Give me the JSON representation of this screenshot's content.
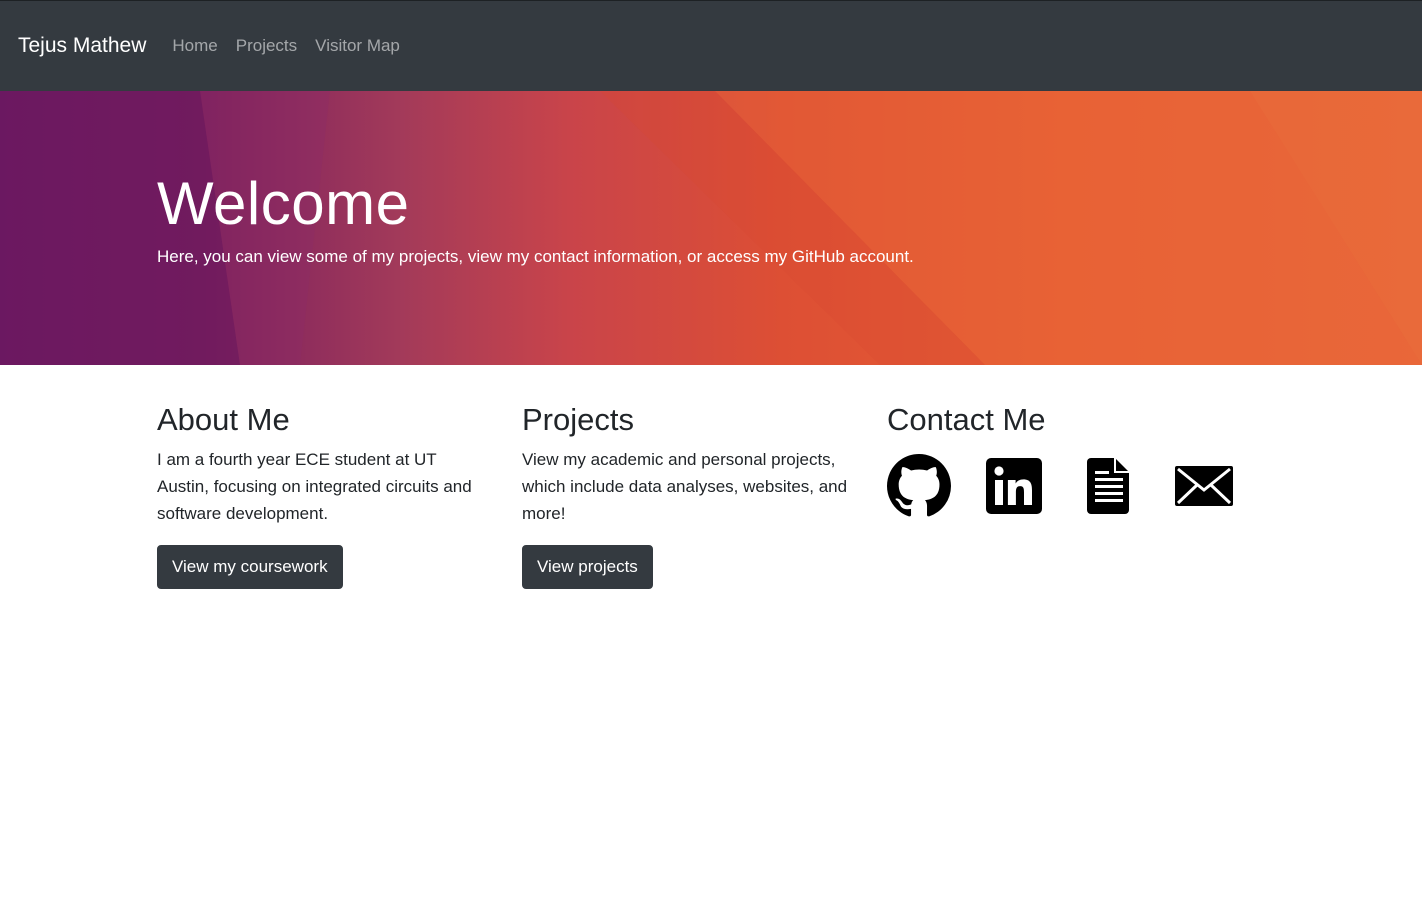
{
  "navbar": {
    "brand": "Tejus Mathew",
    "links": [
      {
        "label": "Home"
      },
      {
        "label": "Projects"
      },
      {
        "label": "Visitor Map"
      }
    ]
  },
  "hero": {
    "title": "Welcome",
    "lead": "Here, you can view some of my projects, view my contact information, or access my GitHub account."
  },
  "about": {
    "heading": "About Me",
    "text": "I am a fourth year ECE student at UT Austin, focusing on integrated circuits and software development.",
    "button": "View my coursework"
  },
  "projects": {
    "heading": "Projects",
    "text": "View my academic and personal projects, which include data analyses, websites, and more!",
    "button": "View projects"
  },
  "contact": {
    "heading": "Contact Me",
    "icons": [
      "github-icon",
      "linkedin-icon",
      "resume-document-icon",
      "email-envelope-icon"
    ]
  },
  "colors": {
    "navbar_bg": "#343a40",
    "button_bg": "#343a40",
    "hero_gradient_start": "#6e1a64",
    "hero_gradient_end": "#e8663a"
  }
}
